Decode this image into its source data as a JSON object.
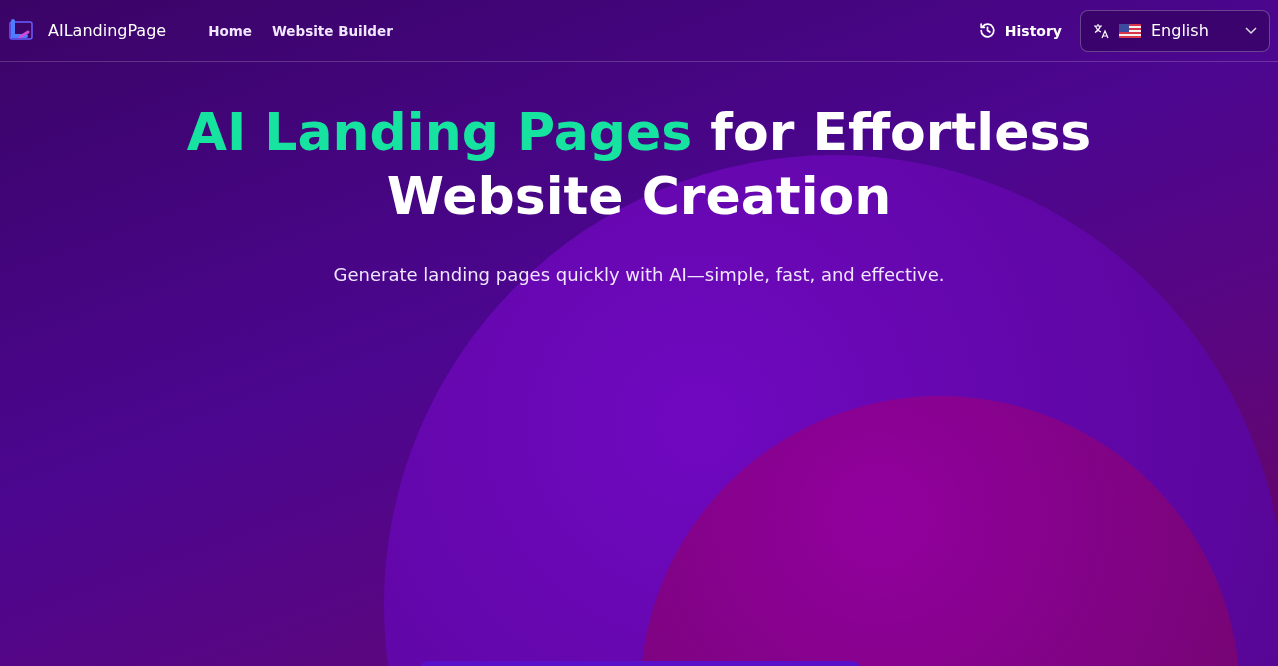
{
  "header": {
    "brand": "AILandingPage",
    "nav": [
      {
        "label": "Home"
      },
      {
        "label": "Website Builder"
      }
    ],
    "history": "History",
    "language": {
      "value": "English"
    }
  },
  "hero": {
    "title_highlight": "AI Landing Pages",
    "title_rest": "for Effortless Website Creation",
    "subtitle": "Generate landing pages quickly with AI—simple, fast, and effective."
  }
}
